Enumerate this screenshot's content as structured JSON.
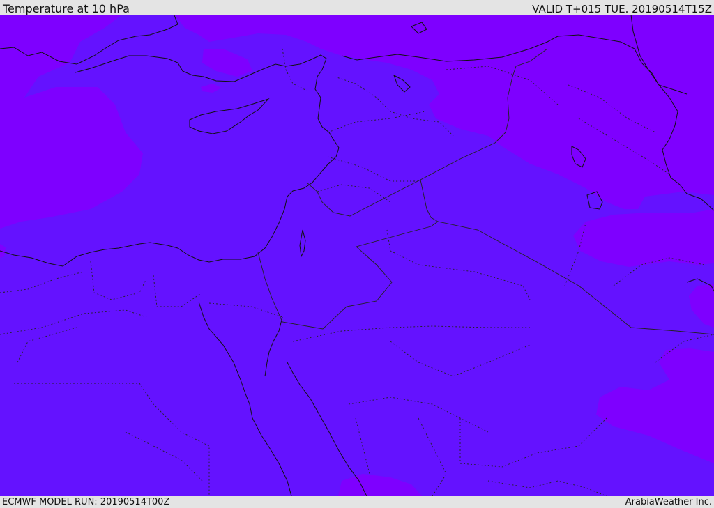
{
  "header": {
    "title": "Temperature at 10 hPa",
    "valid": "VALID T+015 TUE. 20190514T15Z"
  },
  "footer": {
    "model_run": "ECMWF MODEL RUN: 20190514T00Z",
    "credit": "ArabiaWeather Inc."
  },
  "colors": {
    "warmer_field": "#7e00ff",
    "cooler_field": "#6412ff",
    "coastline": "#111111",
    "border": "#222222"
  }
}
